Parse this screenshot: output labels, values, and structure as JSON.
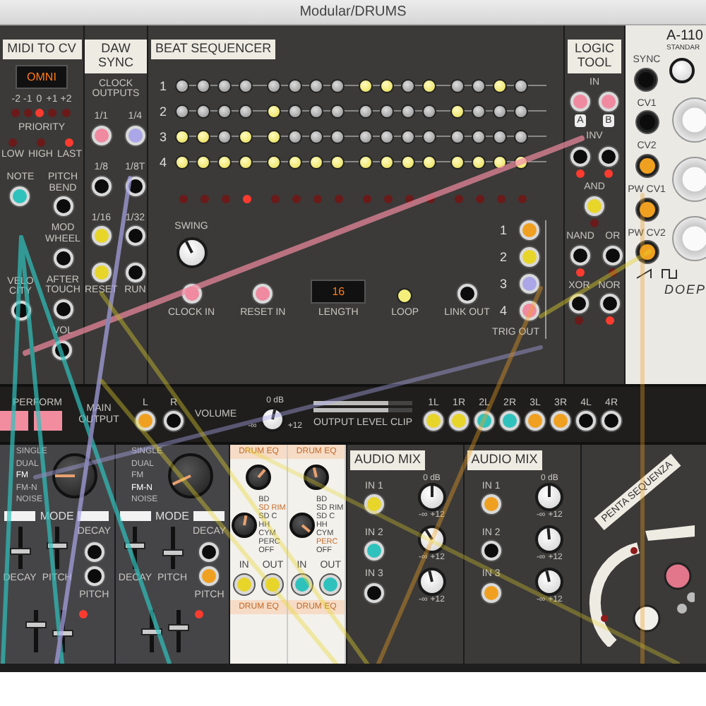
{
  "window": {
    "title": "Modular/DRUMS"
  },
  "midi_to_cv": {
    "title": "MIDI TO CV",
    "channel": "OMNI",
    "octaves": [
      {
        "label": "-2",
        "selected": false
      },
      {
        "label": "-1",
        "selected": false
      },
      {
        "label": "0",
        "selected": true
      },
      {
        "label": "+1",
        "selected": false
      },
      {
        "label": "+2",
        "selected": false
      }
    ],
    "priority_label": "PRIORITY",
    "priorities": [
      {
        "label": "LOW",
        "selected": false
      },
      {
        "label": "HIGH",
        "selected": false
      },
      {
        "label": "LAST",
        "selected": true
      }
    ],
    "jacks_left": [
      {
        "label": "NOTE",
        "color": "#2fc2bd"
      },
      {
        "label": "VELO CITY"
      }
    ],
    "jacks_right": [
      {
        "label": "PITCH BEND"
      },
      {
        "label": "MOD WHEEL"
      },
      {
        "label": "AFTER TOUCH"
      },
      {
        "label": "VOL"
      }
    ]
  },
  "daw_sync": {
    "title": "DAW SYNC",
    "label": "CLOCK OUTPUTS",
    "jacks": [
      {
        "label": "1/1",
        "color": "#f08aa0"
      },
      {
        "label": "1/4",
        "color": "#aaa6e8"
      },
      {
        "label": "1/8"
      },
      {
        "label": "1/8T"
      },
      {
        "label": "1/16",
        "color": "#e8d52a"
      },
      {
        "label": "1/32"
      }
    ],
    "reset_jacks": [
      {
        "label": "RESET",
        "color": "#e8d52a"
      },
      {
        "label": "RUN"
      }
    ]
  },
  "beat_sequencer": {
    "title": "BEAT SEQUENCER",
    "rows": [
      {
        "label": "1",
        "steps": [
          false,
          false,
          false,
          false,
          false,
          false,
          false,
          false,
          true,
          true,
          false,
          true,
          false,
          false,
          true,
          false
        ]
      },
      {
        "label": "2",
        "steps": [
          false,
          false,
          false,
          false,
          true,
          false,
          false,
          false,
          false,
          false,
          false,
          false,
          true,
          false,
          false,
          false
        ]
      },
      {
        "label": "3",
        "steps": [
          true,
          true,
          false,
          true,
          true,
          false,
          false,
          false,
          false,
          false,
          false,
          false,
          false,
          false,
          false,
          false
        ]
      },
      {
        "label": "4",
        "steps": [
          true,
          true,
          true,
          true,
          true,
          true,
          true,
          true,
          true,
          true,
          true,
          true,
          true,
          true,
          true,
          true
        ]
      }
    ],
    "step_leds": [
      {
        "on": false
      },
      {
        "on": false
      },
      {
        "on": false
      },
      {
        "on": true
      },
      {
        "on": false
      },
      {
        "on": false
      },
      {
        "on": false
      },
      {
        "on": false
      },
      {
        "on": false
      },
      {
        "on": false
      },
      {
        "on": false
      },
      {
        "on": false
      },
      {
        "on": false
      },
      {
        "on": false
      },
      {
        "on": false
      },
      {
        "on": false
      }
    ],
    "swing_label": "SWING",
    "swing": {
      "level": 0.4
    },
    "clock_in": {
      "label": "CLOCK IN",
      "color": "#f08aa0"
    },
    "reset_in": {
      "label": "RESET IN",
      "color": "#f08aa0"
    },
    "length": {
      "value": "16",
      "label": "LENGTH"
    },
    "loop": {
      "label": "LOOP",
      "on": true
    },
    "link_out": {
      "label": "LINK OUT"
    },
    "trig_outs": [
      {
        "label": "1",
        "color": "#f0a020"
      },
      {
        "label": "2",
        "color": "#e8d52a"
      },
      {
        "label": "3",
        "color": "#aaa6e8"
      },
      {
        "label": "4",
        "color": "#f08aa0"
      }
    ],
    "trig_label": "TRIG OUT"
  },
  "logic_tool": {
    "title": "LOGIC TOOL",
    "in_label": "IN",
    "inputs": [
      {
        "label": "A",
        "color": "#f08aa0"
      },
      {
        "label": "B",
        "color": "#f08aa0"
      }
    ],
    "inv_label": "INV",
    "inv_outputs": [
      {
        "led_on": true
      },
      {
        "led_on": true
      }
    ],
    "gates": [
      [
        {
          "label": "AND",
          "color": "#e8d52a",
          "led_on": false
        }
      ],
      [
        {
          "label": "NAND",
          "led_on": true
        },
        {
          "label": "OR",
          "led_on": false
        }
      ],
      [
        {
          "label": "XOR",
          "led_on": false
        },
        {
          "label": "NOR",
          "led_on": true
        }
      ]
    ]
  },
  "a110": {
    "title": "A-110",
    "subtitle": "STANDAR",
    "jacks": [
      {
        "label": "SYNC"
      },
      {
        "label": "CV1"
      },
      {
        "label": "CV2",
        "color": "#f0a020"
      },
      {
        "label": "PW CV1",
        "color": "#f0a020"
      },
      {
        "label": "PW CV2",
        "color": "#f0a020"
      }
    ],
    "brand": "DOEP"
  },
  "mixer_strip": {
    "perform_label": "PERFORM",
    "perform_pads": [
      {
        "on": true
      },
      {
        "on": true
      }
    ],
    "main_output_label": "MAIN OUTPUT",
    "channels": [
      {
        "label": "L",
        "color": "#f0a020"
      },
      {
        "label": "R"
      }
    ],
    "volume_label": "VOLUME",
    "volume": {
      "level": 0.55,
      "top": "0 dB",
      "min": "-∞",
      "max": "+12"
    },
    "output_level_label": "OUTPUT LEVEL",
    "meters": [
      {
        "level": 0.75
      },
      {
        "level": 0.75
      }
    ],
    "clip_label": "CLIP",
    "outputs": [
      {
        "label": "1L",
        "color": "#e8d52a"
      },
      {
        "label": "1R",
        "color": "#e8d52a"
      },
      {
        "label": "2L",
        "color": "#2fc2bd"
      },
      {
        "label": "2R",
        "color": "#2fc2bd"
      },
      {
        "label": "3L",
        "color": "#f0a020"
      },
      {
        "label": "3R",
        "color": "#f0a020"
      },
      {
        "label": "4L"
      },
      {
        "label": "4R"
      }
    ]
  },
  "drum_voices": [
    {
      "modes": [
        {
          "label": "SINGLE",
          "selected": false
        },
        {
          "label": "DUAL",
          "selected": false
        },
        {
          "label": "FM",
          "selected": true
        },
        {
          "label": "FM-N",
          "selected": false
        },
        {
          "label": "NOISE",
          "selected": false
        }
      ],
      "mode_label": "MODE",
      "jacks": [
        {
          "label": "DECAY"
        },
        {
          "label": "PITCH"
        }
      ],
      "sliders": [
        {
          "label": "DECAY",
          "level": 0.4
        },
        {
          "label": "PITCH",
          "level": 0.55
        }
      ],
      "lower_sliders": [
        {
          "level": 0.7
        },
        {
          "level": 0.45
        }
      ]
    },
    {
      "modes": [
        {
          "label": "SINGLE",
          "selected": false
        },
        {
          "label": "DUAL",
          "selected": false
        },
        {
          "label": "FM",
          "selected": false
        },
        {
          "label": "FM-N",
          "selected": true
        },
        {
          "label": "NOISE",
          "selected": false
        }
      ],
      "mode_label": "MODE",
      "jacks": [
        {
          "label": "DECAY"
        },
        {
          "label": "PITCH",
          "color": "#f0a020"
        }
      ],
      "sliders": [
        {
          "label": "DECAY",
          "level": 0.55
        },
        {
          "label": "PITCH",
          "level": 0.35
        }
      ],
      "lower_sliders": [
        {
          "level": 0.5
        },
        {
          "level": 0.6
        }
      ]
    }
  ],
  "drum_eqs": [
    {
      "title": "DRUM EQ",
      "knob": {
        "level": 0.65
      },
      "types": [
        {
          "label": "BD",
          "selected": false
        },
        {
          "label": "SD RIM",
          "selected": true
        },
        {
          "label": "SD C",
          "selected": false
        },
        {
          "label": "HH",
          "selected": false
        },
        {
          "label": "CYM",
          "selected": false
        },
        {
          "label": "PERC",
          "selected": false
        },
        {
          "label": "OFF",
          "selected": false
        }
      ],
      "in": {
        "label": "IN",
        "color": "#e8d52a"
      },
      "out": {
        "label": "OUT",
        "color": "#e8d52a"
      },
      "next_title": "DRUM EQ"
    },
    {
      "title": "DRUM EQ",
      "knob": {
        "level": 0.45
      },
      "types": [
        {
          "label": "BD",
          "selected": false
        },
        {
          "label": "SD RIM",
          "selected": false
        },
        {
          "label": "SD C",
          "selected": false
        },
        {
          "label": "HH",
          "selected": false
        },
        {
          "label": "CYM",
          "selected": false
        },
        {
          "label": "PERC",
          "selected": true
        },
        {
          "label": "OFF",
          "selected": false
        }
      ],
      "in": {
        "label": "IN",
        "color": "#2fc2bd"
      },
      "out": {
        "label": "OUT",
        "color": "#2fc2bd"
      },
      "next_title": "DRUM EQ"
    }
  ],
  "audio_mixers": [
    {
      "title": "AUDIO MIX",
      "top_label": "0 dB",
      "channels": [
        {
          "label": "IN 1",
          "color": "#e8d52a",
          "level": 0.5,
          "min": "-∞",
          "max": "+12"
        },
        {
          "label": "IN 2",
          "color": "#2fc2bd",
          "level": 0.38,
          "min": "-∞",
          "max": "+12"
        },
        {
          "label": "IN 3",
          "level": 0.45,
          "min": "-∞",
          "max": "+12"
        }
      ]
    },
    {
      "title": "AUDIO MIX",
      "top_label": "0 dB",
      "channels": [
        {
          "label": "IN 1",
          "color": "#f0a020",
          "level": 0.5,
          "min": "-∞",
          "max": "+12"
        },
        {
          "label": "IN 2",
          "level": 0.48,
          "min": "-∞",
          "max": "+12"
        },
        {
          "label": "IN 3",
          "color": "#f0a020",
          "level": 0.45,
          "min": "-∞",
          "max": "+12"
        }
      ]
    }
  ],
  "penta": {
    "title": "PENTA SEQUENZA"
  }
}
